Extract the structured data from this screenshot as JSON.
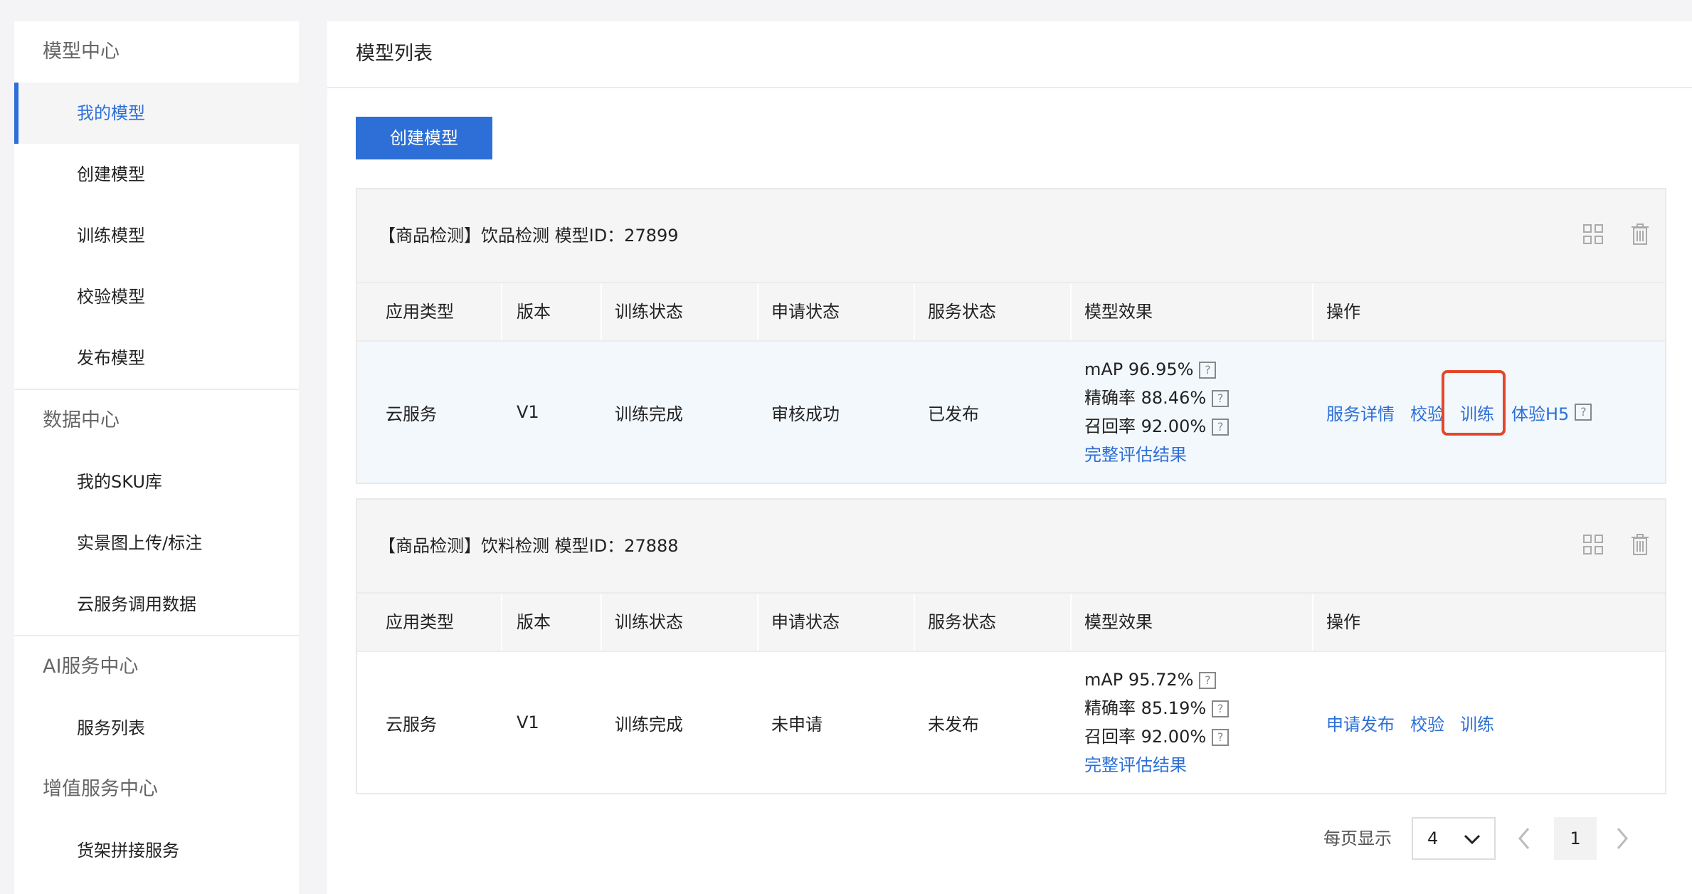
{
  "sidebar": {
    "sections": [
      {
        "title": "模型中心",
        "items": [
          "我的模型",
          "创建模型",
          "训练模型",
          "校验模型",
          "发布模型"
        ]
      },
      {
        "title": "数据中心",
        "items": [
          "我的SKU库",
          "实景图上传/标注",
          "云服务调用数据"
        ]
      },
      {
        "title": "AI服务中心",
        "items": [
          "服务列表"
        ]
      },
      {
        "title": "增值服务中心",
        "items": [
          "货架拼接服务"
        ]
      }
    ],
    "active_item": "我的模型"
  },
  "main": {
    "title": "模型列表",
    "create_button": "创建模型",
    "columns": [
      "应用类型",
      "版本",
      "训练状态",
      "申请状态",
      "服务状态",
      "模型效果",
      "操作"
    ],
    "models": [
      {
        "title": "【商品检测】饮品检测  模型ID：27899",
        "app_type": "云服务",
        "version": "V1",
        "train_status": "训练完成",
        "apply_status": "审核成功",
        "service_status": "已发布",
        "metrics": [
          "mAP  96.95%",
          "精确率  88.46%",
          "召回率  92.00%"
        ],
        "eval_link": "完整评估结果",
        "actions": [
          "服务详情",
          "校验",
          "训练",
          "体验H5"
        ]
      },
      {
        "title": "【商品检测】饮料检测  模型ID：27888",
        "app_type": "云服务",
        "version": "V1",
        "train_status": "训练完成",
        "apply_status": "未申请",
        "service_status": "未发布",
        "metrics": [
          "mAP  95.72%",
          "精确率  85.19%",
          "召回率  92.00%"
        ],
        "eval_link": "完整评估结果",
        "actions": [
          "申请发布",
          "校验",
          "训练"
        ]
      }
    ]
  },
  "pagination": {
    "label": "每页显示",
    "page_size": "4",
    "current_page": "1"
  },
  "colors": {
    "accent": "#2d6fd6",
    "highlight_box": "#e2472b"
  }
}
